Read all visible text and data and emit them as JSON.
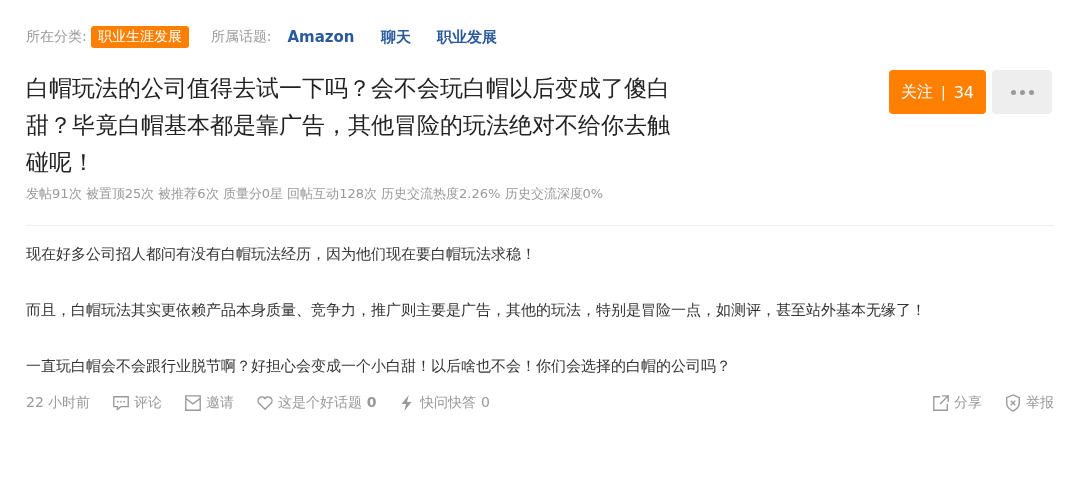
{
  "meta": {
    "category_label": "所在分类:",
    "category": "职业生涯发展",
    "topics_label": "所属话题:",
    "topics": [
      "Amazon",
      "聊天",
      "职业发展"
    ]
  },
  "title": "白帽玩法的公司值得去试一下吗？会不会玩白帽以后变成了傻白甜？毕竟白帽基本都是靠广告，其他冒险的玩法绝对不给你去触碰呢！",
  "follow": {
    "label": "关注",
    "separator": "|",
    "count": "34"
  },
  "stats": "发帖91次 被置顶25次 被推荐6次 质量分0星 回帖互动128次 历史交流热度2.26% 历史交流深度0%",
  "paragraphs": [
    "现在好多公司招人都问有没有白帽玩法经历，因为他们现在要白帽玩法求稳！",
    "而且，白帽玩法其实更依赖产品本身质量、竞争力，推广则主要是广告，其他的玩法，特别是冒险一点，如测评，甚至站外基本无缘了！",
    "一直玩白帽会不会跟行业脱节啊？好担心会变成一个小白甜！以后啥也不会！你们会选择的白帽的公司吗？"
  ],
  "footer": {
    "time": "22 小时前",
    "actions": [
      {
        "kind": "comment",
        "label": "评论"
      },
      {
        "kind": "invite",
        "label": "邀请"
      },
      {
        "kind": "like",
        "label": "这是个好话题 **0**"
      },
      {
        "kind": "quick",
        "label": "快问快答 0"
      }
    ],
    "right_actions": [
      {
        "kind": "share",
        "label": "分享"
      },
      {
        "kind": "report",
        "label": "举报"
      }
    ]
  }
}
